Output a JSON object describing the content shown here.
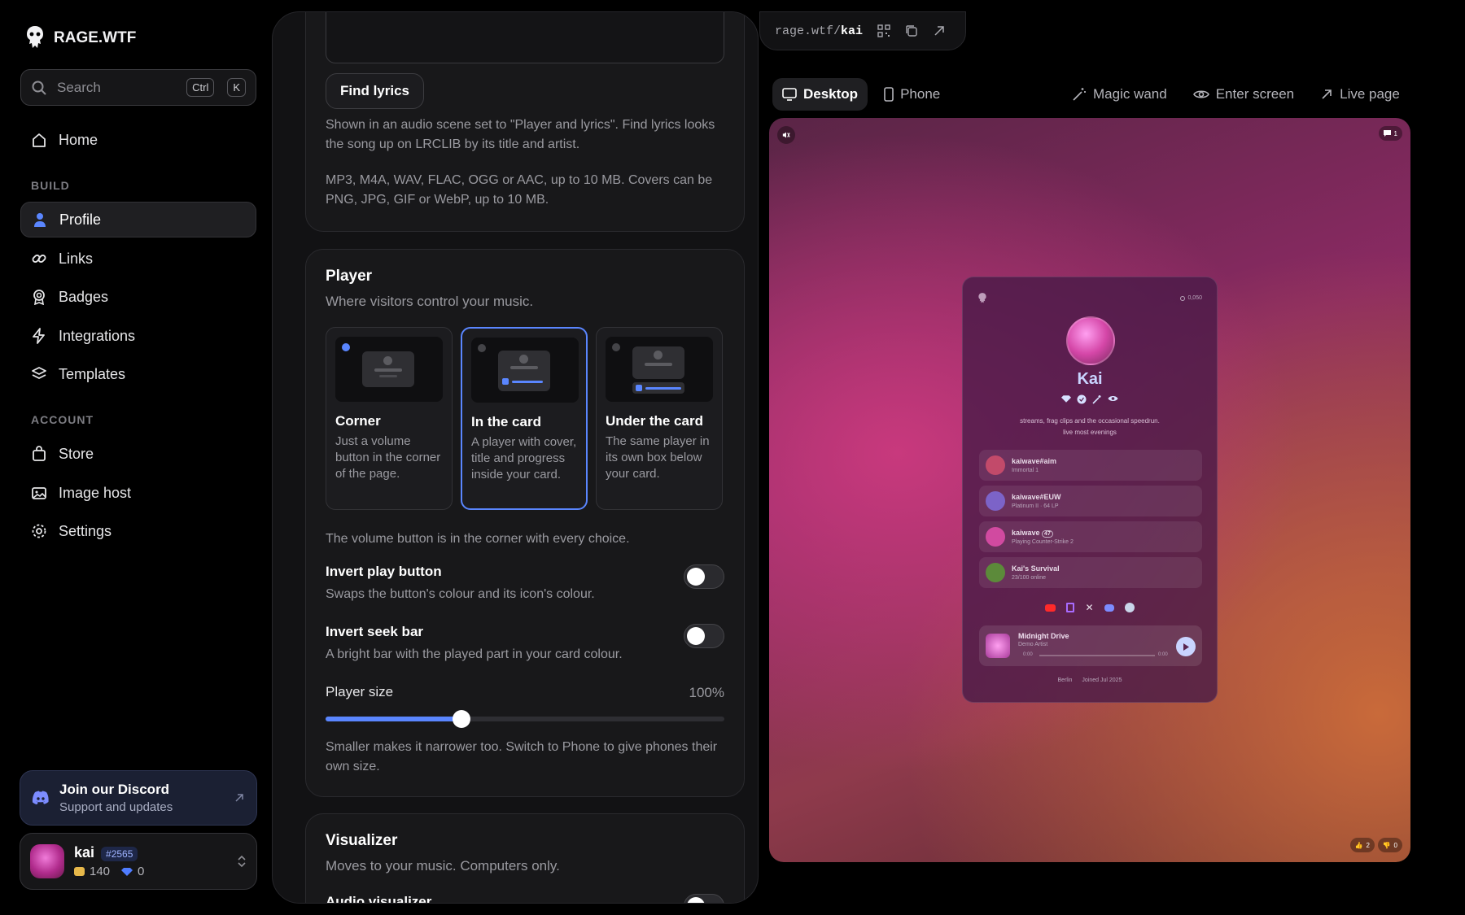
{
  "sidebar": {
    "brand": "RAGE.WTF",
    "search": {
      "placeholder": "Search",
      "kbd1": "Ctrl",
      "kbd2": "K"
    },
    "home": "Home",
    "build_label": "BUILD",
    "build_items": [
      "Profile",
      "Links",
      "Badges",
      "Integrations",
      "Templates"
    ],
    "account_label": "ACCOUNT",
    "account_items": [
      "Store",
      "Image host",
      "Settings"
    ],
    "discord": {
      "title": "Join our Discord",
      "subtitle": "Support and updates"
    },
    "user": {
      "name": "kai",
      "tag": "#2565",
      "coins": "140",
      "gems": "0"
    }
  },
  "editor": {
    "find_lyrics": "Find lyrics",
    "lyrics_note": "Shown in an audio scene set to \"Player and lyrics\". Find lyrics looks the song up on LRCLIB by its title and artist.",
    "formats_note": "MP3, M4A, WAV, FLAC, OGG or AAC, up to 10 MB. Covers can be PNG, JPG, GIF or WebP, up to 10 MB.",
    "player": {
      "title": "Player",
      "subtitle": "Where visitors control your music.",
      "options": [
        {
          "name": "Corner",
          "desc": "Just a volume button in the corner of the page."
        },
        {
          "name": "In the card",
          "desc": "A player with cover, title and progress inside your card."
        },
        {
          "name": "Under the card",
          "desc": "The same player in its own box below your card."
        }
      ],
      "selected": 1,
      "note": "The volume button is in the corner with every choice.",
      "invert_play_title": "Invert play button",
      "invert_play_desc": "Swaps the button's colour and its icon's colour.",
      "invert_seek_title": "Invert seek bar",
      "invert_seek_desc": "A bright bar with the played part in your card colour.",
      "size_label": "Player size",
      "size_value": "100%",
      "size_fraction": 0.34,
      "size_note": "Smaller makes it narrower too. Switch to Phone to give phones their own size."
    },
    "visualizer": {
      "title": "Visualizer",
      "subtitle": "Moves to your music. Computers only.",
      "audio_label": "Audio visualizer"
    }
  },
  "preview": {
    "url_prefix": "rage.wtf/",
    "url_user": "kai",
    "tab_desktop": "Desktop",
    "tab_phone": "Phone",
    "magic": "Magic wand",
    "enter": "Enter screen",
    "live": "Live page",
    "comments": "1",
    "likes": "2",
    "dislikes": "0",
    "profile": {
      "views": "0,050",
      "name": "Kai",
      "bio1": "streams, frag clips and the occasional speedrun.",
      "bio2": "live most evenings",
      "items": [
        {
          "title": "kaiwave#aim",
          "sub": "Immortal 1",
          "color": "#c24a6a"
        },
        {
          "title": "kaiwave#EUW",
          "sub": "Platinum II  ·  64 LP",
          "color": "#7c63c8"
        },
        {
          "title": "kaiwave",
          "badge": "47",
          "sub": "Playing Counter-Strike 2",
          "color": "#d14aa0"
        },
        {
          "title": "Kai's Survival",
          "sub": "23/100 online",
          "color": "#5c8a3a"
        }
      ],
      "song": "Midnight Drive",
      "artist": "Demo Artist",
      "t0": "0:00",
      "t1": "0:00",
      "location": "Berlin",
      "joined": "Joined Jul 2025"
    }
  }
}
